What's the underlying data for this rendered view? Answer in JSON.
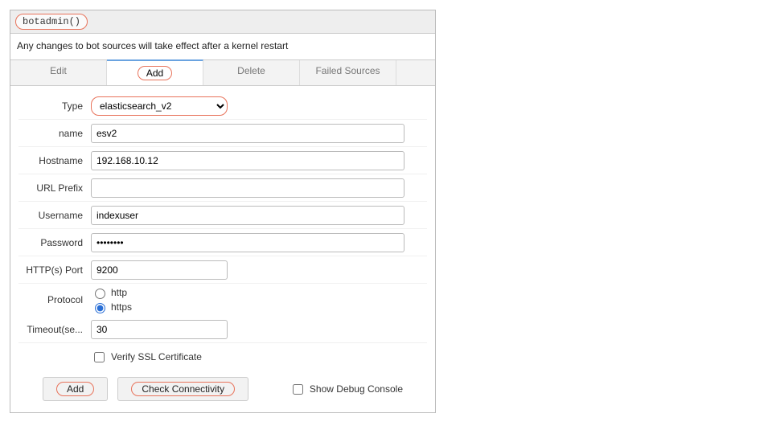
{
  "title": "botadmin()",
  "notice": "Any changes to bot sources will take effect after a kernel restart",
  "tabs": {
    "edit": "Edit",
    "add": "Add",
    "delete": "Delete",
    "failed": "Failed Sources"
  },
  "labels": {
    "type": "Type",
    "name": "name",
    "hostname": "Hostname",
    "urlprefix": "URL Prefix",
    "username": "Username",
    "password": "Password",
    "port": "HTTP(s) Port",
    "protocol": "Protocol",
    "timeout": "Timeout(se...",
    "verifyssl": "Verify SSL Certificate",
    "showdebug": "Show Debug Console"
  },
  "fields": {
    "type_value": "elasticsearch_v2",
    "name": "esv2",
    "hostname": "192.168.10.12",
    "urlprefix": "",
    "username": "indexuser",
    "password": "••••••••",
    "port": "9200",
    "protocol_http": "http",
    "protocol_https": "https",
    "protocol_selected": "https",
    "timeout": "30",
    "verifyssl_checked": false,
    "showdebug_checked": false
  },
  "buttons": {
    "add": "Add",
    "check": "Check Connectivity"
  }
}
